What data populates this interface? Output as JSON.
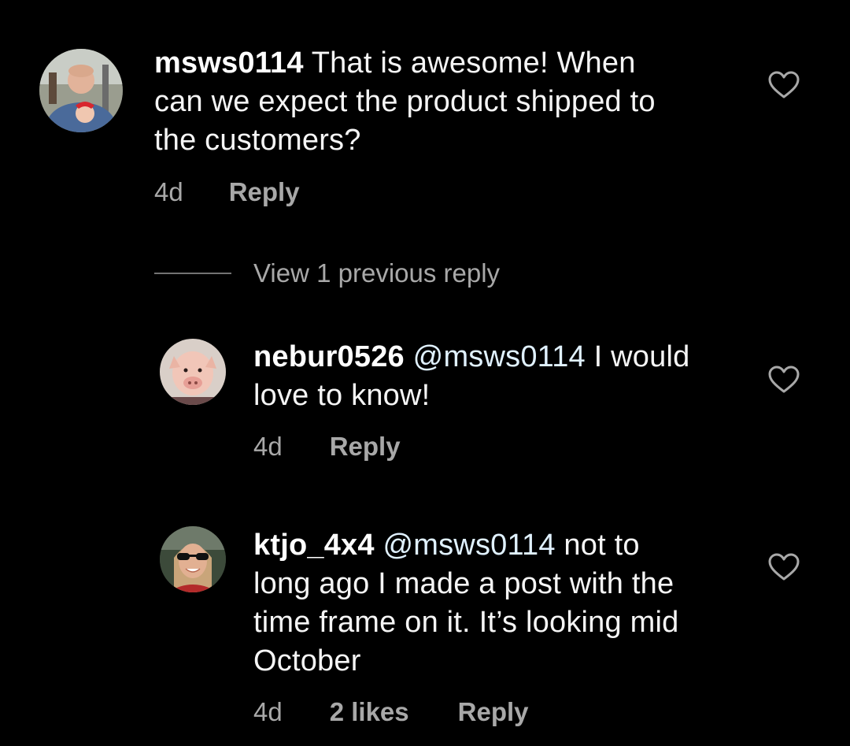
{
  "comments": [
    {
      "username": "msws0114",
      "mention": "",
      "text_lines": [
        "That is awesome!  When",
        "can we expect the product shipped to",
        "the customers?"
      ],
      "time": "4d",
      "likes": "",
      "reply_label": "Reply",
      "avatar_icon": "profile-photo-man-with-baby"
    },
    {
      "username": "nebur0526",
      "mention": "@msws0114",
      "text_lines": [
        "I would",
        "love to know!"
      ],
      "time": "4d",
      "likes": "",
      "reply_label": "Reply",
      "avatar_icon": "profile-photo-pig"
    },
    {
      "username": "ktjo_4x4",
      "mention": "@msws0114",
      "text_lines": [
        "not to",
        "long ago I made a post with the",
        "time frame on it. It’s looking mid",
        "October"
      ],
      "time": "4d",
      "likes": "2 likes",
      "reply_label": "Reply",
      "avatar_icon": "profile-photo-woman-sunglasses"
    }
  ],
  "view_replies": {
    "label": "View 1 previous reply"
  },
  "colors": {
    "background": "#000000",
    "text": "#f5f5f5",
    "meta": "#a8a8a8",
    "mention": "#e0f1ff",
    "heart_stroke": "#a8a8a8"
  }
}
